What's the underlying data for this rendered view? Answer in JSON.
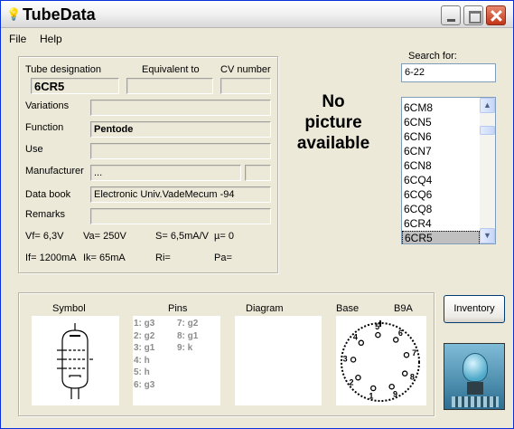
{
  "window": {
    "title": "TubeData",
    "icon": "bulb-icon"
  },
  "menu": {
    "file": "File",
    "help": "Help"
  },
  "header_labels": {
    "designation": "Tube designation",
    "equivalent": "Equivalent to",
    "cv": "CV number"
  },
  "fields": {
    "designation": "6CR5",
    "equivalent": "",
    "cv": "",
    "variations_label": "Variations",
    "variations": "",
    "function_label": "Function",
    "function": "Pentode",
    "use_label": "Use",
    "use": "",
    "manufacturer_label": "Manufacturer",
    "manufacturer": "...",
    "manufacturer_extra": "",
    "databook_label": "Data book",
    "databook": "Electronic Univ.VadeMecum -94",
    "remarks_label": "Remarks",
    "remarks": ""
  },
  "specs": {
    "vf": "Vf= 6,3V",
    "va": "Va=  250V",
    "s": "S= 6,5mA/V",
    "mu": "µ=    0",
    "if": "If= 1200mA",
    "ik": "Ik=   65mA",
    "ri": "Ri=",
    "pa": "Pa="
  },
  "picture": {
    "line1": "No",
    "line2": "picture",
    "line3": "available"
  },
  "search": {
    "label": "Search for:",
    "value": "6-22"
  },
  "tube_list": {
    "items": [
      "6CM8",
      "6CN5",
      "6CN6",
      "6CN7",
      "6CN8",
      "6CQ4",
      "6CQ6",
      "6CQ8",
      "6CR4",
      "6CR5"
    ],
    "selected": "6CR5"
  },
  "bottom": {
    "symbol_label": "Symbol",
    "pins_label": "Pins",
    "diagram_label": "Diagram",
    "base_label": "Base",
    "base_type": "B9A",
    "pins_col1": [
      "1: g3",
      "2: g2",
      "3: g1",
      "4: h",
      "5: h",
      "6: g3"
    ],
    "pins_col2": [
      "7: g2",
      "8: g1",
      "9: k"
    ],
    "base_numbers": [
      "5",
      "4",
      "6",
      "3",
      "7",
      "2",
      "8",
      "1",
      "9"
    ]
  },
  "buttons": {
    "inventory": "Inventory"
  }
}
